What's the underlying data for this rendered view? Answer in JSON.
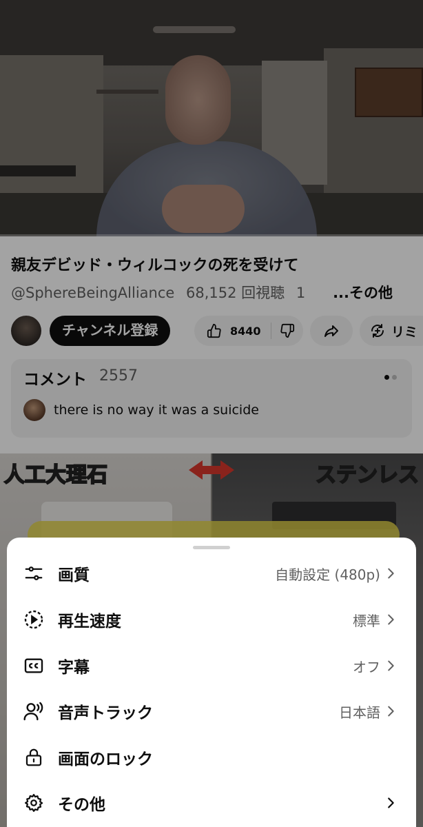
{
  "video": {
    "progress_fraction": 0.0,
    "title": "親友デビッド・ウィルコックの死を受けて",
    "channel_handle": "@SphereBeingAlliance",
    "views": "68,152 回視聴",
    "truncated_time": "1",
    "more_label": "...その他"
  },
  "actions": {
    "subscribe_label": "チャンネル登録",
    "like_count": "8440",
    "remix_label": "リミ"
  },
  "comments": {
    "title": "コメント",
    "count": "2557",
    "preview_text": "there is no way it was a suicide"
  },
  "next_video": {
    "label_left": "人工大理石",
    "label_right": "ステンレス"
  },
  "sheet": {
    "items": [
      {
        "label": "画質",
        "value": "自動設定 (480p)",
        "icon": "quality-sliders-icon"
      },
      {
        "label": "再生速度",
        "value": "標準",
        "icon": "playback-speed-icon"
      },
      {
        "label": "字幕",
        "value": "オフ",
        "icon": "captions-icon"
      },
      {
        "label": "音声トラック",
        "value": "日本語",
        "icon": "audio-track-icon"
      },
      {
        "label": "画面のロック",
        "value": "",
        "icon": "lock-icon"
      },
      {
        "label": "その他",
        "value": "",
        "icon": "gear-icon"
      }
    ]
  },
  "colors": {
    "accent_red": "#ff0000",
    "subscribe_bg": "#0f0f0f",
    "sheet_bg": "#ffffff"
  }
}
